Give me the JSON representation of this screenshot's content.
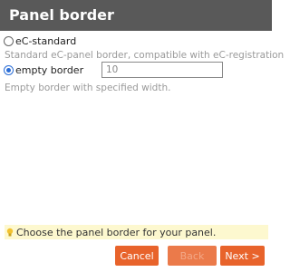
{
  "header": {
    "title": "Panel border"
  },
  "options": [
    {
      "label": "eC-standard",
      "checked": false,
      "description": "Standard eC-panel border, compatible with eC-registration"
    },
    {
      "label": "empty border",
      "checked": true,
      "value": "10",
      "description": "Empty border with specified width."
    }
  ],
  "hint": {
    "text": "Choose the panel border for your panel.",
    "icon": "lightbulb-icon"
  },
  "buttons": {
    "cancel": "Cancel",
    "back": "Back",
    "next": "Next >"
  },
  "colors": {
    "header_bg": "#595959",
    "accent": "#e8632b",
    "hint_bg": "#fdf8cf",
    "radio_selected": "#2a6dd6"
  }
}
